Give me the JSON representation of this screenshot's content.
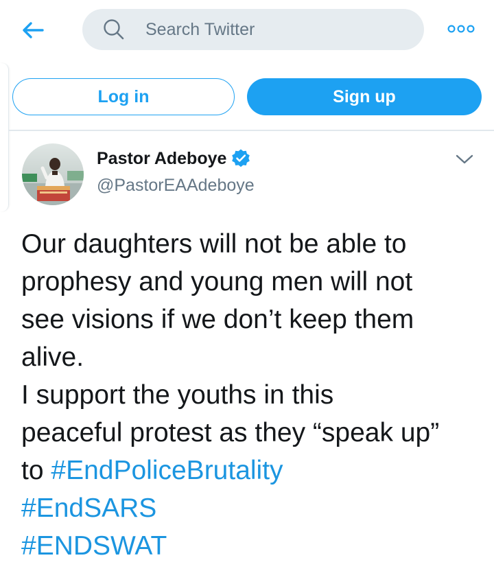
{
  "header": {
    "search_placeholder": "Search Twitter",
    "back_icon": "arrow-left-icon",
    "search_icon": "search-icon",
    "more_icon": "more-dots-icon"
  },
  "auth": {
    "login_label": "Log in",
    "signup_label": "Sign up"
  },
  "tweet": {
    "author_name": "Pastor Adeboye",
    "author_handle": "@PastorEAAdeboye",
    "verified": true,
    "lines": [
      "Our daughters will not be able to",
      "prophesy and young men will not",
      "see visions if we don’t keep them",
      "alive.",
      "I support the youths in this",
      "peaceful protest as they “speak up”"
    ],
    "line7_prefix": "to ",
    "hashtags": [
      "#EndPoliceBrutality",
      "#EndSARS",
      "#ENDSWAT"
    ]
  },
  "colors": {
    "accent": "#1da1f2",
    "hashtag": "#1b95e0",
    "secondary_text": "#657786",
    "search_bg": "#e6ecf0"
  }
}
